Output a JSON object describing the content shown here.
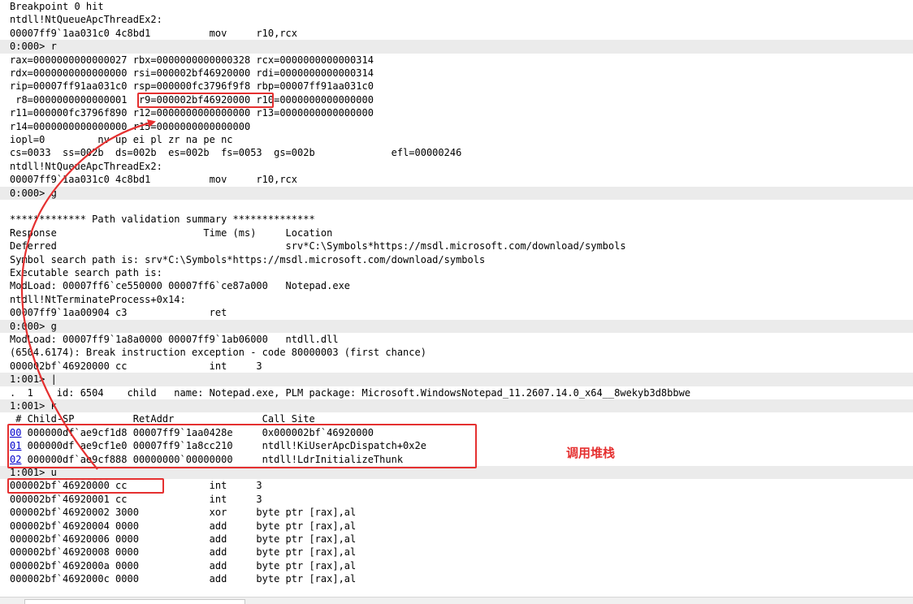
{
  "console": {
    "lines": [
      "Breakpoint 0 hit",
      "ntdll!NtQueueApcThreadEx2:",
      "00007ff9`1aa031c0 4c8bd1          mov     r10,rcx",
      "0:000> r",
      "rax=0000000000000027 rbx=0000000000000328 rcx=0000000000000314",
      "rdx=0000000000000000 rsi=000002bf46920000 rdi=0000000000000314",
      "rip=00007ff91aa031c0 rsp=000000fc3796f9f8 rbp=00007ff91aa031c0",
      " r8=0000000000000001  r9=000002bf46920000 r10=0000000000000000",
      "r11=000000fc3796f890 r12=0000000000000000 r13=0000000000000000",
      "r14=0000000000000000 r15=0000000000000000",
      "iopl=0         nv up ei pl zr na pe nc",
      "cs=0033  ss=002b  ds=002b  es=002b  fs=0053  gs=002b             efl=00000246",
      "ntdll!NtQueueApcThreadEx2:",
      "00007ff9`1aa031c0 4c8bd1          mov     r10,rcx",
      "0:000> g",
      "",
      "************* Path validation summary **************",
      "Response                         Time (ms)     Location",
      "Deferred                                       srv*C:\\Symbols*https://msdl.microsoft.com/download/symbols",
      "Symbol search path is: srv*C:\\Symbols*https://msdl.microsoft.com/download/symbols",
      "Executable search path is:",
      "ModLoad: 00007ff6`ce550000 00007ff6`ce87a000   Notepad.exe",
      "ntdll!NtTerminateProcess+0x14:",
      "00007ff9`1aa00904 c3              ret",
      "0:000> g",
      "ModLoad: 00007ff9`1a8a0000 00007ff9`1ab06000   ntdll.dll",
      "(6504.6174): Break instruction exception - code 80000003 (first chance)",
      "000002bf`46920000 cc              int     3",
      "1:001> |",
      ".  1    id: 6504    child   name: Notepad.exe, PLM package: Microsoft.WindowsNotepad_11.2607.14.0_x64__8wekyb3d8bbwe",
      "1:001> k",
      " # Child-SP          RetAddr               Call Site"
    ],
    "stack": [
      {
        "frame": "00",
        "rest": " 000000df`ae9cf1d8 00007ff9`1aa0428e     0x000002bf`46920000"
      },
      {
        "frame": "01",
        "rest": " 000000df`ae9cf1e0 00007ff9`1a8cc210     ntdll!KiUserApcDispatch+0x2e"
      },
      {
        "frame": "02",
        "rest": " 000000df`ae9cf888 00000000`00000000     ntdll!LdrInitializeThunk"
      }
    ],
    "tail": [
      "1:001> u",
      "000002bf`46920000 cc              int     3",
      "000002bf`46920001 cc              int     3",
      "000002bf`46920002 3000            xor     byte ptr [rax],al",
      "000002bf`46920004 0000            add     byte ptr [rax],al",
      "000002bf`46920006 0000            add     byte ptr [rax],al",
      "000002bf`46920008 0000            add     byte ptr [rax],al",
      "000002bf`4692000a 0000            add     byte ptr [rax],al",
      "000002bf`4692000c 0000            add     byte ptr [rax],al"
    ]
  },
  "annotation": {
    "label": "调用堆栈",
    "color": "#e53030"
  }
}
